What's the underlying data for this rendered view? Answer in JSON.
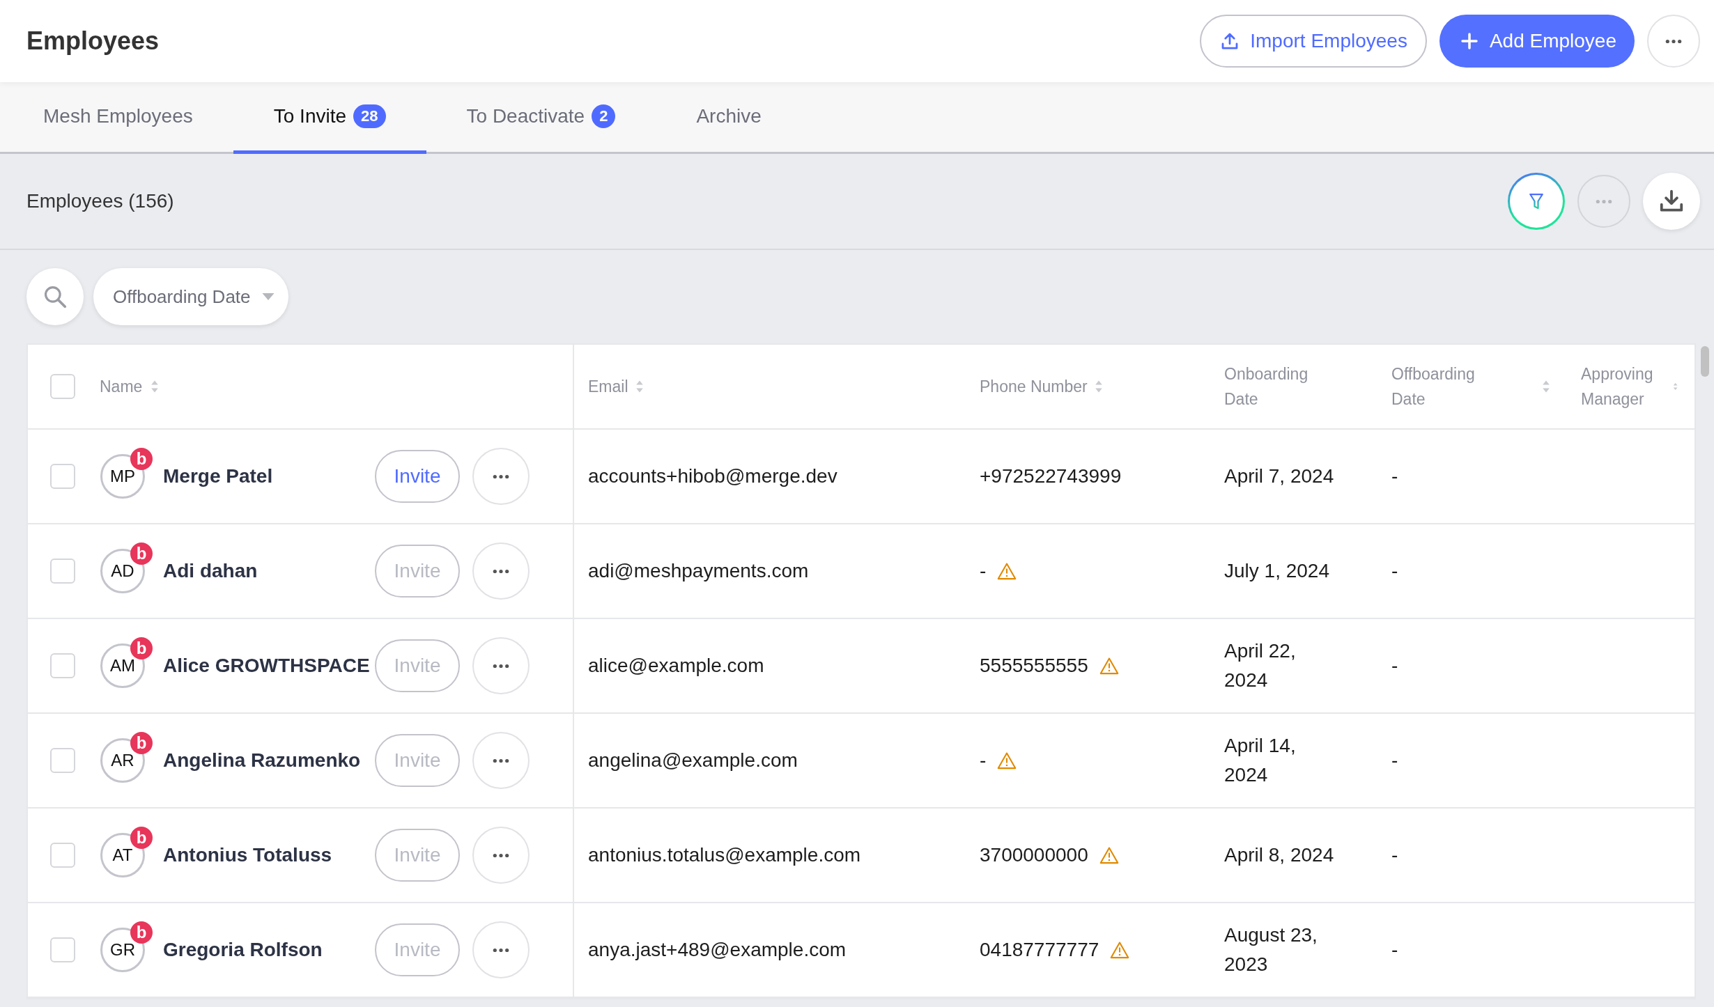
{
  "header": {
    "title": "Employees",
    "import_button": "Import Employees",
    "add_button": "Add Employee"
  },
  "tabs": [
    {
      "label": "Mesh Employees",
      "selected": false
    },
    {
      "label": "To Invite",
      "count": "28",
      "selected": true
    },
    {
      "label": "To Deactivate",
      "count": "2",
      "selected": false
    },
    {
      "label": "Archive",
      "selected": false
    }
  ],
  "section": {
    "title": "Employees (156)"
  },
  "filters": {
    "date_filter": "Offboarding Date"
  },
  "table": {
    "select_all_checked": false,
    "columns": [
      {
        "label": "Name",
        "sortable": true
      },
      {
        "label": "Email",
        "sortable": true
      },
      {
        "label": "Phone Number",
        "sortable": true
      },
      {
        "label": "Onboarding Date",
        "sortable": false
      },
      {
        "label": "Offboarding Date",
        "sortable": true
      },
      {
        "label": "Approving Manager",
        "sortable": true
      }
    ],
    "rows": [
      {
        "initials": "MP",
        "badge": "b",
        "name": "Merge Patel",
        "invite": "Invite",
        "invite_disabled": false,
        "email": "accounts+hibob@merge.dev",
        "phone": "+972522743999",
        "phone_warning": false,
        "onboarding": "April 7, 2024",
        "offboarding": "-",
        "checked": false
      },
      {
        "initials": "AD",
        "badge": "b",
        "name": "Adi dahan",
        "invite": "Invite",
        "invite_disabled": true,
        "email": "adi@meshpayments.com",
        "phone": "-",
        "phone_warning": true,
        "onboarding": "July 1, 2024",
        "offboarding": "-",
        "checked": false
      },
      {
        "initials": "AM",
        "badge": "b",
        "name": "Alice GROWTHSPACE",
        "invite": "Invite",
        "invite_disabled": true,
        "email": "alice@example.com",
        "phone": "5555555555",
        "phone_warning": true,
        "onboarding": "April 22, 2024",
        "offboarding": "-",
        "checked": false
      },
      {
        "initials": "AR",
        "badge": "b",
        "name": "Angelina Razumenko",
        "invite": "Invite",
        "invite_disabled": true,
        "email": "angelina@example.com",
        "phone": "-",
        "phone_warning": true,
        "onboarding": "April 14, 2024",
        "offboarding": "-",
        "checked": false
      },
      {
        "initials": "AT",
        "badge": "b",
        "name": "Antonius Totaluss",
        "invite": "Invite",
        "invite_disabled": true,
        "email": "antonius.totalus@example.com",
        "phone": "3700000000",
        "phone_warning": true,
        "onboarding": "April 8, 2024",
        "offboarding": "-",
        "checked": false
      },
      {
        "initials": "GR",
        "badge": "b",
        "name": "Gregoria Rolfson",
        "invite": "Invite",
        "invite_disabled": true,
        "email": "anya.jast+489@example.com",
        "phone": "04187777777",
        "phone_warning": true,
        "onboarding": "August 23, 2023",
        "offboarding": "-",
        "checked": false
      }
    ]
  }
}
